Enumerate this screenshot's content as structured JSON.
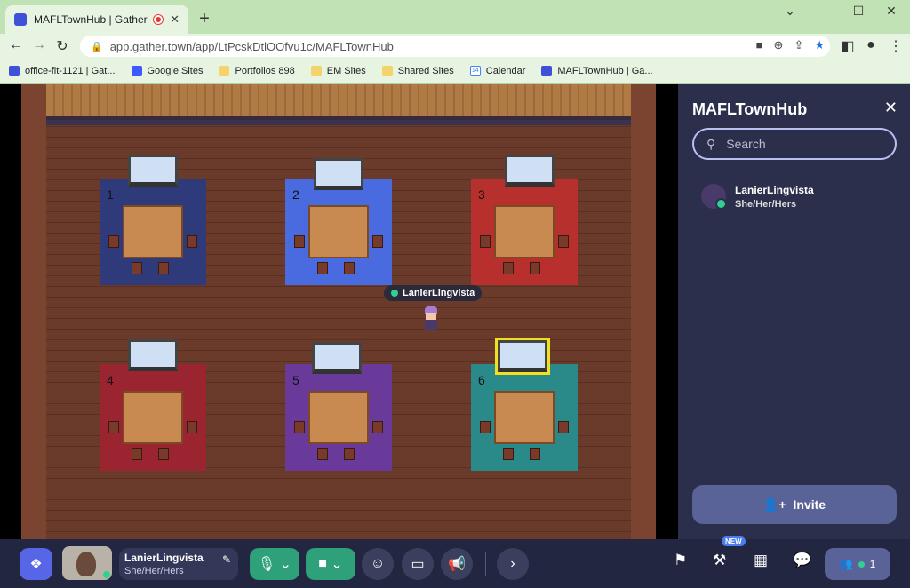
{
  "browser": {
    "tab_title": "MAFLTownHub | Gather",
    "url": "app.gather.town/app/LtPcskDtlOOfvu1c/MAFLTownHub",
    "bookmarks": [
      {
        "label": "office-flt-1121 | Gat...",
        "icon": "gather"
      },
      {
        "label": "Google Sites",
        "icon": "gsites"
      },
      {
        "label": "Portfolios 898",
        "icon": "folder"
      },
      {
        "label": "EM Sites",
        "icon": "folder"
      },
      {
        "label": "Shared Sites",
        "icon": "folder"
      },
      {
        "label": "Calendar",
        "icon": "cal"
      },
      {
        "label": "MAFLTownHub | Ga...",
        "icon": "gather"
      }
    ]
  },
  "map": {
    "player_name": "LanierLingvista",
    "rugs": [
      {
        "num": "1",
        "color": "#2e3a7a"
      },
      {
        "num": "2",
        "color": "#4a6ae0"
      },
      {
        "num": "3",
        "color": "#b8302e"
      },
      {
        "num": "4",
        "color": "#9a2430"
      },
      {
        "num": "5",
        "color": "#6a3a9a"
      },
      {
        "num": "6",
        "color": "#2a8a8a"
      }
    ]
  },
  "panel": {
    "title": "MAFLTownHub",
    "search_placeholder": "Search",
    "users": [
      {
        "name": "LanierLingvista",
        "pronouns": "She/Her/Hers"
      }
    ],
    "invite_label": "Invite"
  },
  "bottombar": {
    "name": "LanierLingvista",
    "pronouns": "She/Her/Hers",
    "new_badge": "NEW",
    "people_count": "1"
  }
}
